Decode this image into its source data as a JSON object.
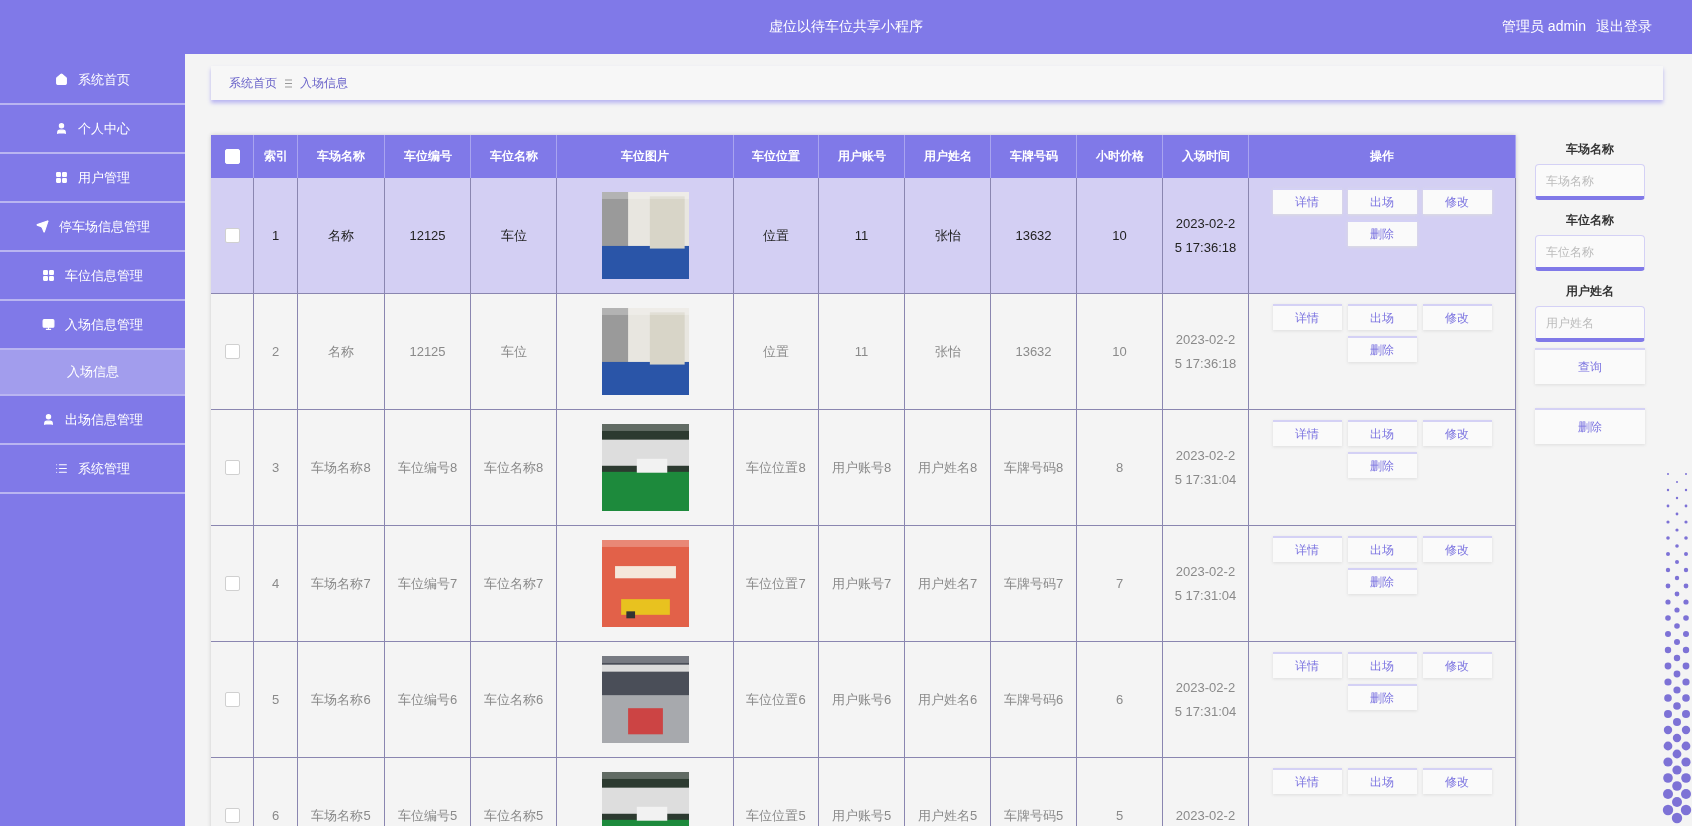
{
  "header": {
    "title": "虚位以待车位共享小程序",
    "user": "管理员 admin",
    "logout": "退出登录"
  },
  "sidebar": {
    "items": [
      {
        "label": "系统首页"
      },
      {
        "label": "个人中心"
      },
      {
        "label": "用户管理"
      },
      {
        "label": "停车场信息管理"
      },
      {
        "label": "车位信息管理"
      },
      {
        "label": "入场信息管理",
        "children": [
          {
            "label": "入场信息",
            "selected": true
          }
        ]
      },
      {
        "label": "出场信息管理"
      },
      {
        "label": "系统管理"
      }
    ]
  },
  "breadcrumb": [
    "系统首页",
    "入场信息"
  ],
  "table": {
    "select_all": {
      "checked": false
    },
    "columns": [
      "索引",
      "车场名称",
      "车位编号",
      "车位名称",
      "车位图片",
      "车位位置",
      "用户账号",
      "用户姓名",
      "车牌号码",
      "小时价格",
      "入场时间",
      "操作"
    ],
    "rows": [
      {
        "selected": true,
        "checked": false,
        "cells": [
          "1",
          "名称",
          "12125",
          "车位"
        ],
        "image": {
          "kind": "picture"
        },
        "cells_after": [
          "位置",
          "11",
          "张怡",
          "13632",
          "10",
          "2023-02-25 17:36:18"
        ],
        "actions": [
          "详情",
          "出场",
          "修改",
          "删除"
        ]
      },
      {
        "selected": false,
        "checked": false,
        "cells": [
          "2",
          "名称",
          "12125",
          "车位"
        ],
        "image": {
          "kind": "picture"
        },
        "cells_after": [
          "位置",
          "11",
          "张怡",
          "13632",
          "10",
          "2023-02-25 17:36:18"
        ],
        "actions": [
          "详情",
          "出场",
          "修改",
          "删除"
        ]
      },
      {
        "selected": false,
        "checked": false,
        "cells": [
          "3",
          "车场名称8",
          "车位编号8",
          "车位名称8"
        ],
        "image": {
          "kind": "picture"
        },
        "cells_after": [
          "车位位置8",
          "用户账号8",
          "用户姓名8",
          "车牌号码8",
          "8",
          "2023-02-25 17:31:04"
        ],
        "actions": [
          "详情",
          "出场",
          "修改",
          "删除"
        ]
      },
      {
        "selected": false,
        "checked": false,
        "cells": [
          "4",
          "车场名称7",
          "车位编号7",
          "车位名称7"
        ],
        "image": {
          "kind": "picture"
        },
        "cells_after": [
          "车位位置7",
          "用户账号7",
          "用户姓名7",
          "车牌号码7",
          "7",
          "2023-02-25 17:31:04"
        ],
        "actions": [
          "详情",
          "出场",
          "修改",
          "删除"
        ]
      },
      {
        "selected": false,
        "checked": false,
        "cells": [
          "5",
          "车场名称6",
          "车位编号6",
          "车位名称6"
        ],
        "image": {
          "kind": "picture"
        },
        "cells_after": [
          "车位位置6",
          "用户账号6",
          "用户姓名6",
          "车牌号码6",
          "6",
          "2023-02-25 17:31:04"
        ],
        "actions": [
          "详情",
          "出场",
          "修改",
          "删除"
        ]
      },
      {
        "selected": false,
        "checked": false,
        "cells": [
          "6",
          "车场名称5",
          "车位编号5",
          "车位名称5"
        ],
        "image": {
          "kind": "picture"
        },
        "cells_after": [
          "车位位置5",
          "用户账号5",
          "用户姓名5",
          "车牌号码5",
          "5",
          "2023-02-2"
        ],
        "actions": [
          "详情",
          "出场",
          "修改"
        ]
      }
    ]
  },
  "search": {
    "fields": [
      {
        "label": "车场名称",
        "placeholder": "车场名称"
      },
      {
        "label": "车位名称",
        "placeholder": "车位名称"
      },
      {
        "label": "用户姓名",
        "placeholder": "用户姓名"
      }
    ],
    "query_button": "查询",
    "delete_button": "删除"
  }
}
